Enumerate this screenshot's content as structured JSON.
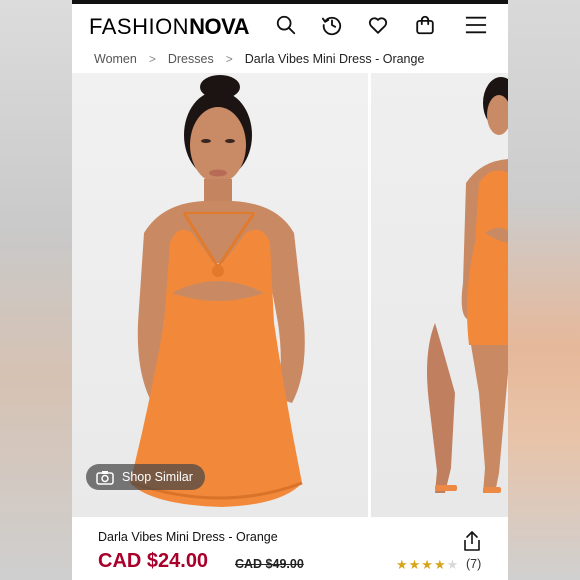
{
  "header": {
    "logo_thin": "FASHION",
    "logo_bold": "NOVA",
    "icons": [
      "search-icon",
      "history-icon",
      "heart-icon",
      "bag-icon",
      "menu-icon"
    ]
  },
  "breadcrumb": {
    "items": [
      "Women",
      "Dresses",
      "Darla Vibes Mini Dress - Orange"
    ],
    "separator": ">"
  },
  "gallery": {
    "shop_similar_label": "Shop Similar",
    "product_color": "#f2893a"
  },
  "product": {
    "name": "Darla Vibes Mini Dress - Orange",
    "price": "CAD $24.00",
    "original_price": "CAD $49.00",
    "rating_stars": 4,
    "rating_max": 5,
    "review_count": "(7)",
    "price_color": "#a8002b"
  }
}
